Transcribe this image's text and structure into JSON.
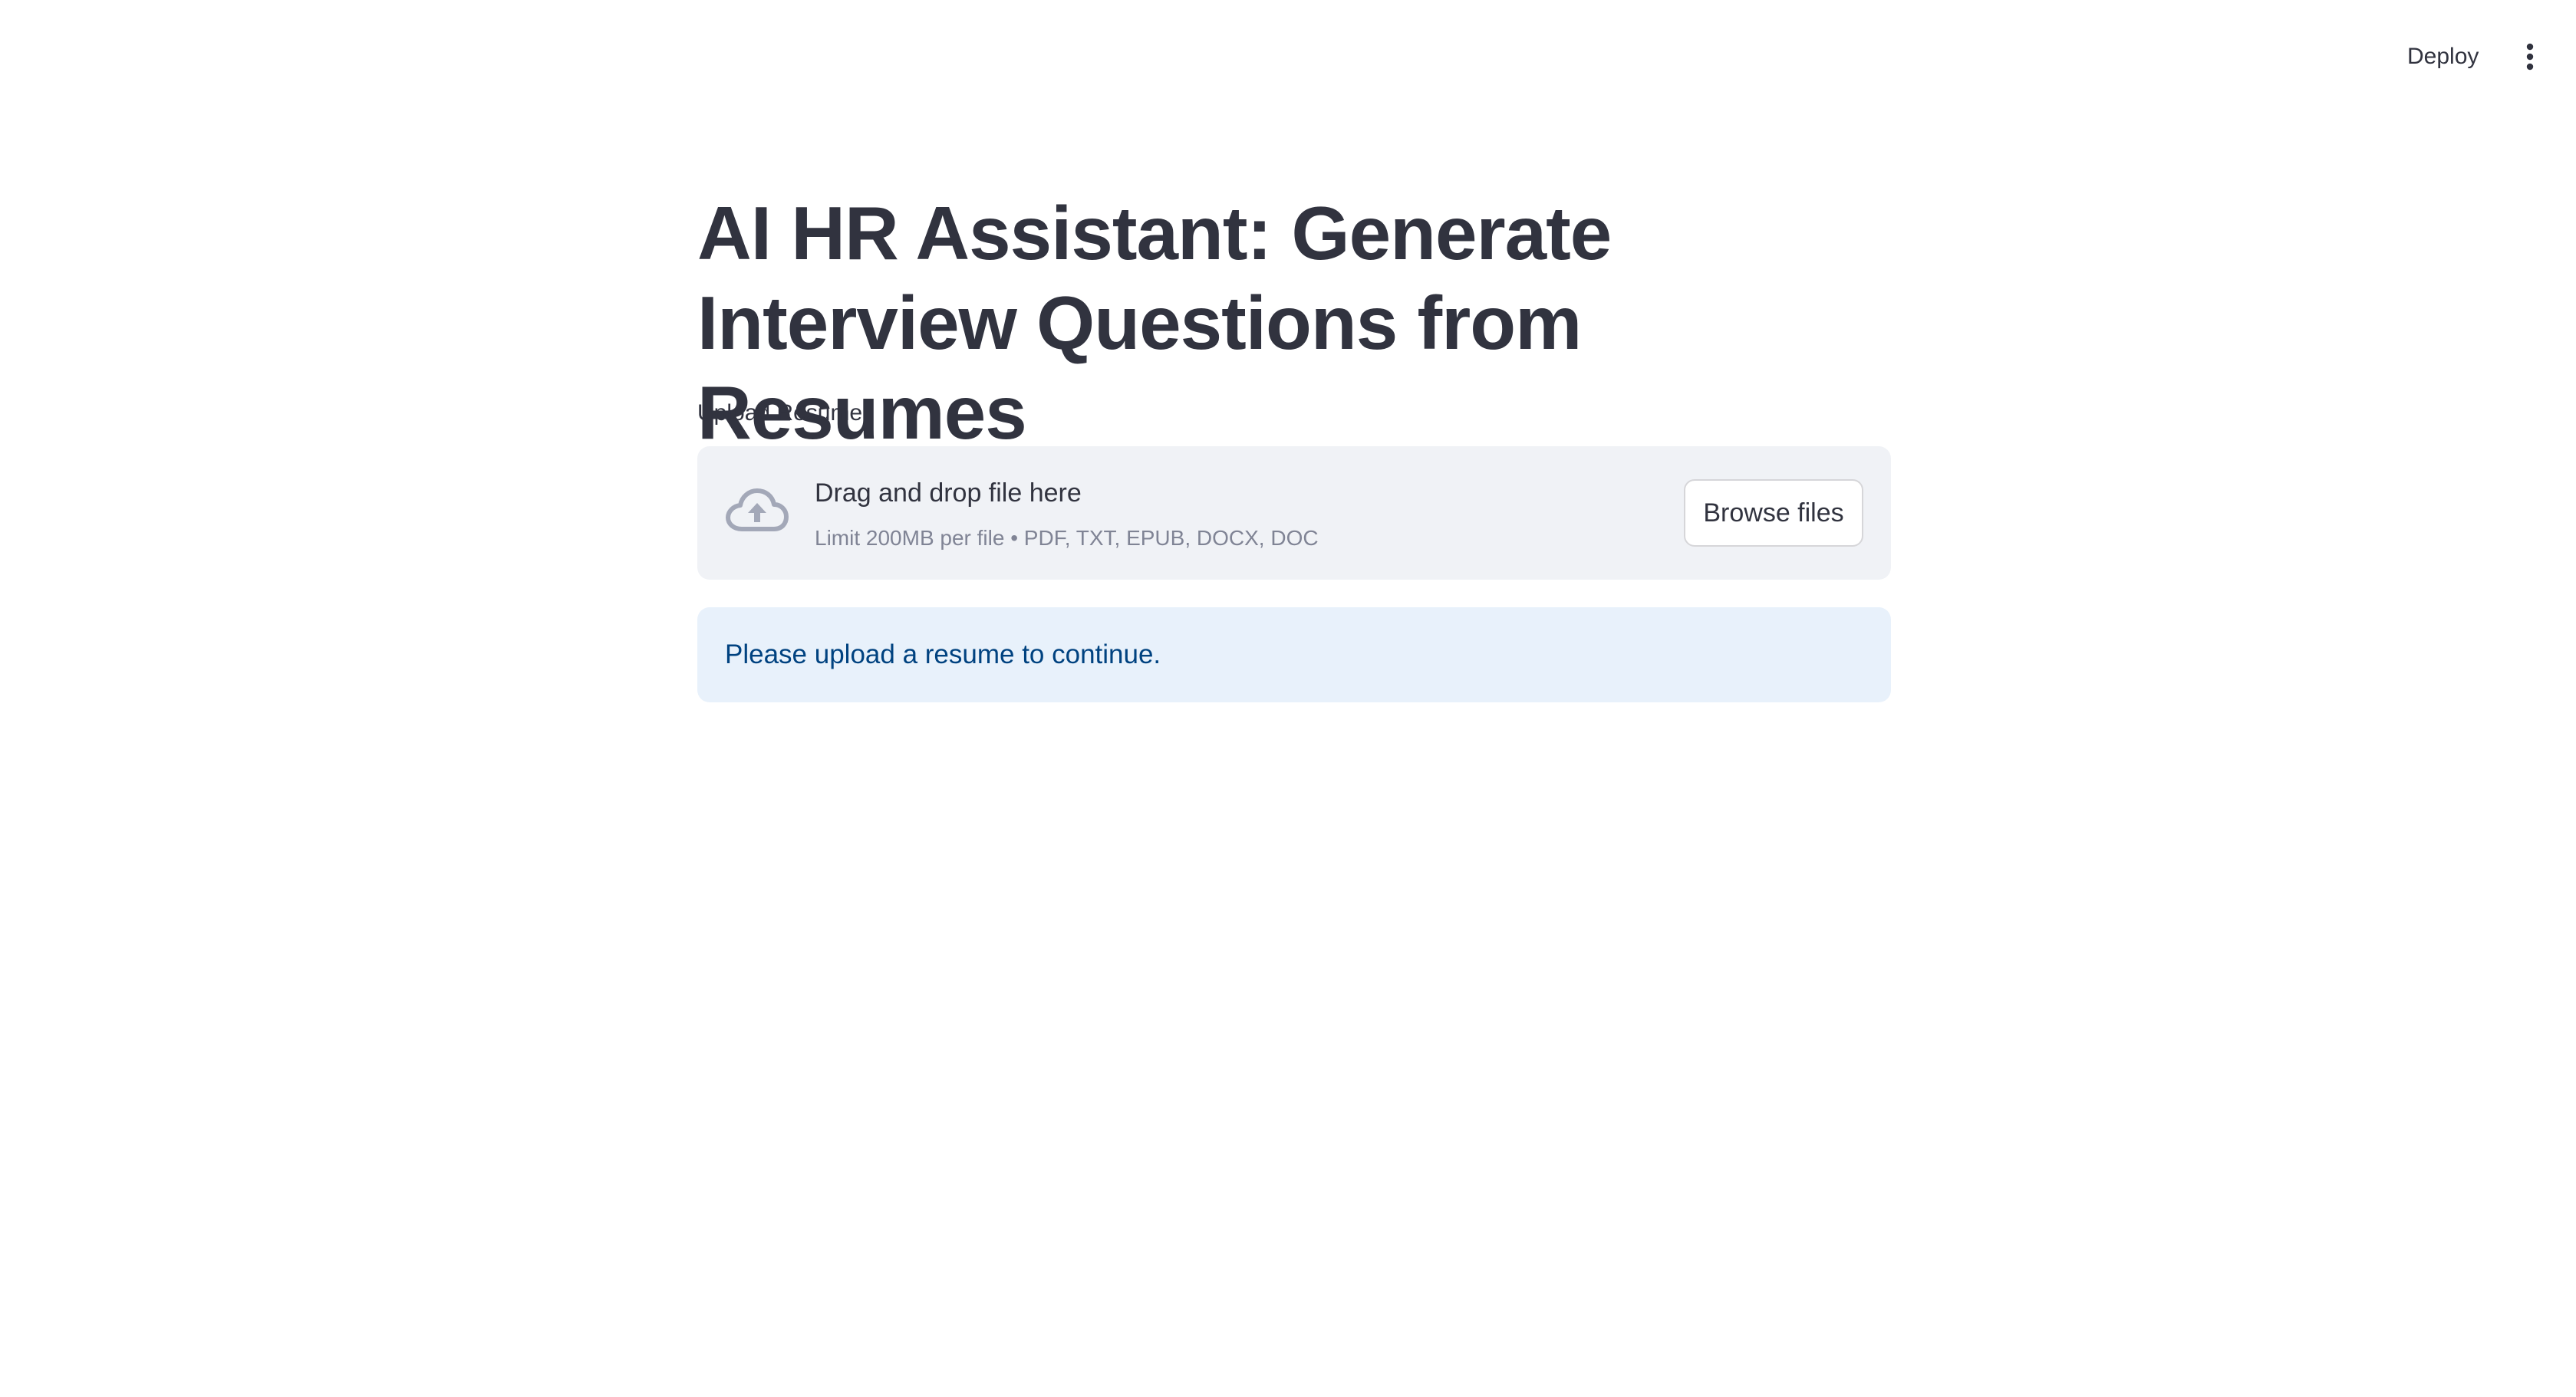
{
  "header": {
    "deploy_label": "Deploy",
    "menu_icon": "vertical-ellipsis-icon"
  },
  "main": {
    "title": "AI HR Assistant: Generate Interview Questions from Resumes",
    "uploader": {
      "label": "Upload Resume",
      "icon": "cloud-upload-icon",
      "instruction": "Drag and drop file here",
      "limit_text": "Limit 200MB per file • PDF, TXT, EPUB, DOCX, DOC",
      "browse_label": "Browse files"
    },
    "info_message": "Please upload a resume to continue."
  },
  "colors": {
    "text": "#31333f",
    "muted": "#808495",
    "dropzone_bg": "#f0f2f6",
    "info_bg": "#e8f1fb",
    "info_text": "#004280",
    "icon": "#a3a8b8"
  }
}
